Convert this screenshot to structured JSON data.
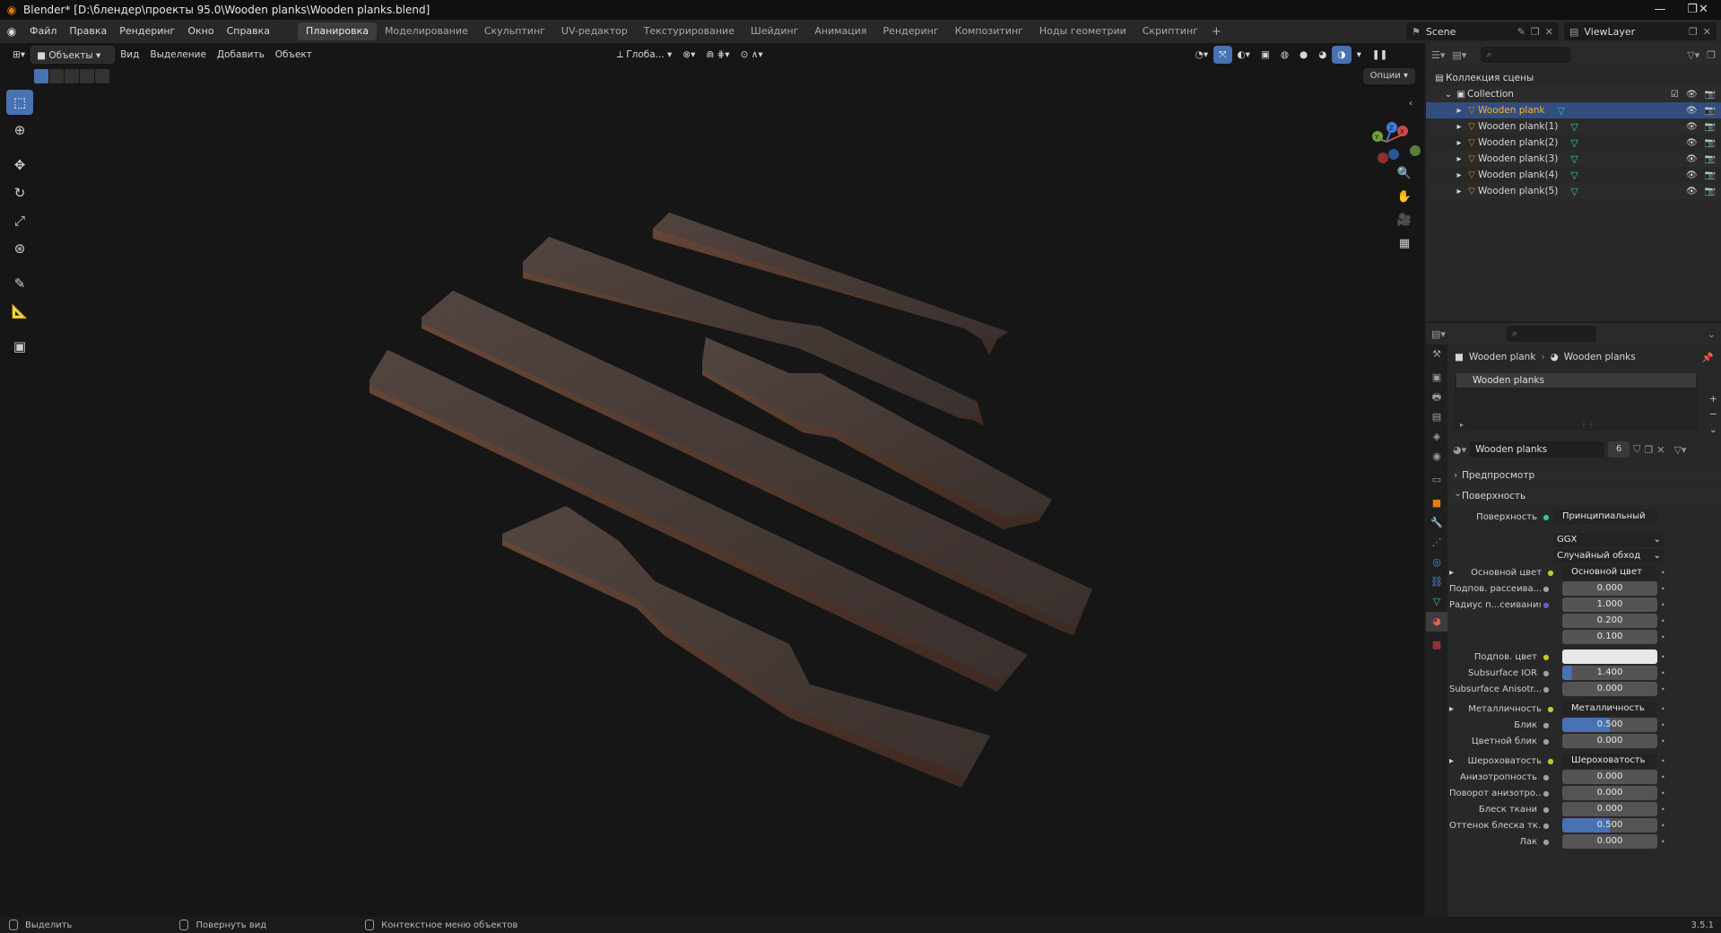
{
  "window": {
    "title": "Blender* [D:\\блендер\\проекты 95.0\\Wooden planks\\Wooden planks.blend]"
  },
  "menu": [
    "Файл",
    "Правка",
    "Рендеринг",
    "Окно",
    "Справка"
  ],
  "workspaces": [
    "Планировка",
    "Моделирование",
    "Скульптинг",
    "UV-редактор",
    "Текстурирование",
    "Шейдинг",
    "Анимация",
    "Рендеринг",
    "Композитинг",
    "Ноды геометрии",
    "Скриптинг"
  ],
  "active_workspace": "Планировка",
  "scene": "Scene",
  "view_layer": "ViewLayer",
  "viewport": {
    "mode": "Объекты",
    "menu": [
      "Вид",
      "Выделение",
      "Добавить",
      "Объект"
    ],
    "orientation": "Глоба...",
    "options": "Опции",
    "gizmo_axes": [
      "X",
      "Y",
      "Z"
    ]
  },
  "outliner": {
    "scene_collection": "Коллекция сцены",
    "collection": "Collection",
    "objects": [
      "Wooden plank",
      "Wooden plank(1)",
      "Wooden plank(2)",
      "Wooden plank(3)",
      "Wooden plank(4)",
      "Wooden plank(5)"
    ]
  },
  "properties": {
    "breadcrumb": [
      "Wooden plank",
      "Wooden planks"
    ],
    "material_slot": "Wooden planks",
    "material_name": "Wooden planks",
    "material_users": "6",
    "panels": {
      "preview": "Предпросмотр",
      "surface": "Поверхность"
    },
    "surface_label": "Поверхность",
    "surface_shader": "Принципиальный BSDF",
    "distribution": "GGX",
    "subsurface_method": "Случайный обход",
    "rows": [
      {
        "label": "Основной цвет",
        "value": "Основной цвет",
        "kind": "link"
      },
      {
        "label": "Подпов. рассеива...",
        "value": "0.000",
        "kind": "num"
      },
      {
        "label": "Радиус п...сеивания",
        "value": "1.000",
        "kind": "num"
      },
      {
        "label": "",
        "value": "0.200",
        "kind": "num"
      },
      {
        "label": "",
        "value": "0.100",
        "kind": "num"
      },
      {
        "label": "Подпов. цвет",
        "value": "",
        "kind": "color"
      },
      {
        "label": "Subsurface IOR",
        "value": "1.400",
        "kind": "fill",
        "fill": 0.1
      },
      {
        "label": "Subsurface Anisotr...",
        "value": "0.000",
        "kind": "num"
      },
      {
        "label": "Металличность",
        "value": "Металличность",
        "kind": "link"
      },
      {
        "label": "Блик",
        "value": "0.500",
        "kind": "fill",
        "fill": 0.5
      },
      {
        "label": "Цветной блик",
        "value": "0.000",
        "kind": "num"
      },
      {
        "label": "Шероховатость",
        "value": "Шероховатость",
        "kind": "link"
      },
      {
        "label": "Анизотропность",
        "value": "0.000",
        "kind": "num"
      },
      {
        "label": "Поворот анизотро...",
        "value": "0.000",
        "kind": "num"
      },
      {
        "label": "Блеск ткани",
        "value": "0.000",
        "kind": "num"
      },
      {
        "label": "Оттенок блеска тк...",
        "value": "0.500",
        "kind": "fill",
        "fill": 0.5
      },
      {
        "label": "Лак",
        "value": "0.000",
        "kind": "num"
      }
    ]
  },
  "status": {
    "select": "Выделить",
    "rotate": "Повернуть вид",
    "context": "Контекстное меню объектов",
    "version": "3.5.1"
  },
  "colors": {
    "accent": "#4772b3",
    "selection": "#334d80",
    "mesh": "#2fd08b",
    "object": "#e87d0d",
    "wood": "#4a3d38"
  }
}
